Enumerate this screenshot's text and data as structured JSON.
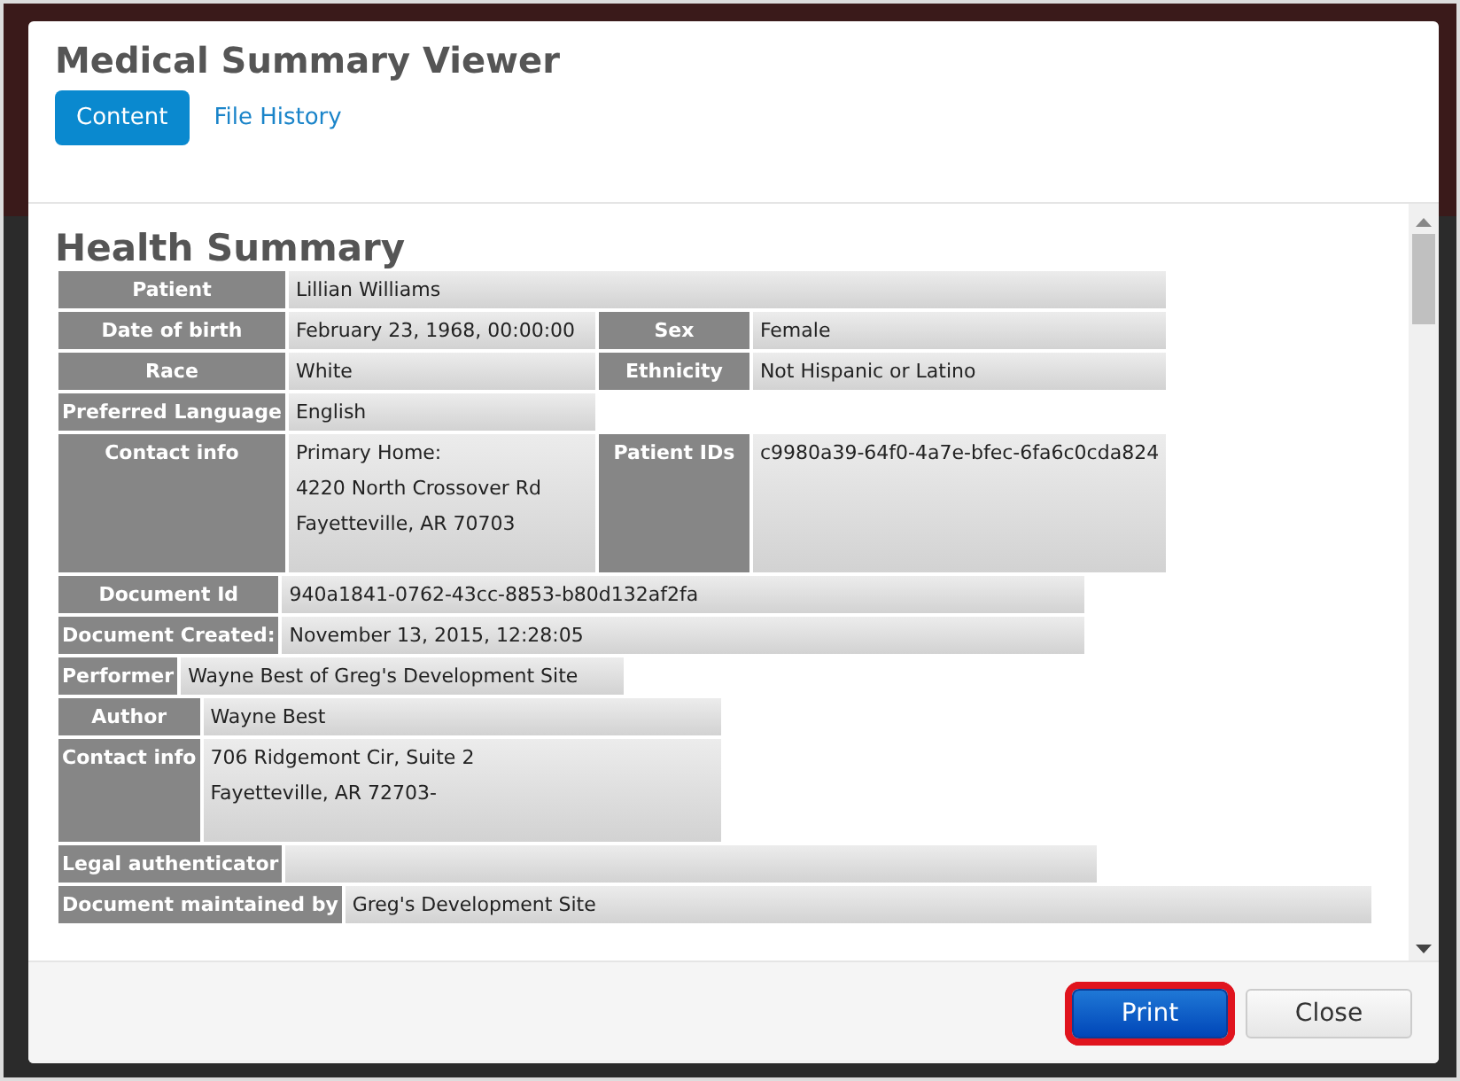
{
  "window": {
    "title": "Medical Summary Viewer"
  },
  "tabs": [
    {
      "label": "Content",
      "selected": true
    },
    {
      "label": "File History",
      "selected": false
    }
  ],
  "heading": "Health Summary",
  "groups": [
    [
      [
        {
          "kind": "label",
          "text": "Patient"
        },
        {
          "kind": "wide-value",
          "lines": [
            "Lillian Williams"
          ]
        }
      ],
      [
        {
          "kind": "label",
          "text": "Date of birth"
        },
        {
          "kind": "value",
          "lines": [
            "February 23, 1968, 00:00:00"
          ]
        },
        {
          "kind": "label",
          "text": "Sex"
        },
        {
          "kind": "value",
          "lines": [
            "Female"
          ]
        }
      ],
      [
        {
          "kind": "label",
          "text": "Race"
        },
        {
          "kind": "value",
          "lines": [
            "White"
          ]
        },
        {
          "kind": "label",
          "text": "Ethnicity"
        },
        {
          "kind": "value",
          "lines": [
            "Not Hispanic or Latino"
          ]
        }
      ],
      [
        {
          "kind": "label",
          "text": "Preferred Language"
        },
        {
          "kind": "value",
          "lines": [
            "English"
          ]
        }
      ],
      [
        {
          "kind": "label",
          "text": "Contact info"
        },
        {
          "kind": "value",
          "lines": [
            "Primary Home:",
            "4220 North Crossover Rd",
            "Fayetteville, AR 70703"
          ]
        },
        {
          "kind": "label",
          "text": "Patient IDs"
        },
        {
          "kind": "value",
          "lines": [
            "c9980a39-64f0-4a7e-bfec-6fa6c0cda824"
          ]
        }
      ]
    ],
    [
      [
        {
          "kind": "label",
          "text": "Document Id"
        },
        {
          "kind": "value",
          "lines": [
            "940a1841-0762-43cc-8853-b80d132af2fa"
          ]
        }
      ],
      [
        {
          "kind": "label",
          "text": "Document Created:"
        },
        {
          "kind": "value",
          "lines": [
            "November 13, 2015, 12:28:05"
          ]
        }
      ]
    ],
    [
      [
        {
          "kind": "label",
          "text": "Performer"
        },
        {
          "kind": "value",
          "lines": [
            "Wayne Best of Greg's Development Site"
          ]
        }
      ]
    ],
    [
      [
        {
          "kind": "label",
          "text": "Author"
        },
        {
          "kind": "value",
          "lines": [
            "Wayne Best"
          ]
        }
      ],
      [
        {
          "kind": "label",
          "text": "Contact info"
        },
        {
          "kind": "value",
          "lines": [
            "706 Ridgemont Cir, Suite 2",
            "Fayetteville, AR 72703-"
          ]
        }
      ]
    ],
    [
      [
        {
          "kind": "label",
          "text": "Legal authenticator"
        },
        {
          "kind": "value"
        }
      ]
    ],
    [
      [
        {
          "kind": "label",
          "text": "Document maintained by"
        },
        {
          "kind": "value",
          "lines": [
            "Greg's Development Site"
          ]
        }
      ]
    ]
  ],
  "buttons": [
    {
      "label": "Print",
      "kind": "primary",
      "highlighted": true
    },
    {
      "label": "Close",
      "kind": "default",
      "highlighted": false
    }
  ]
}
